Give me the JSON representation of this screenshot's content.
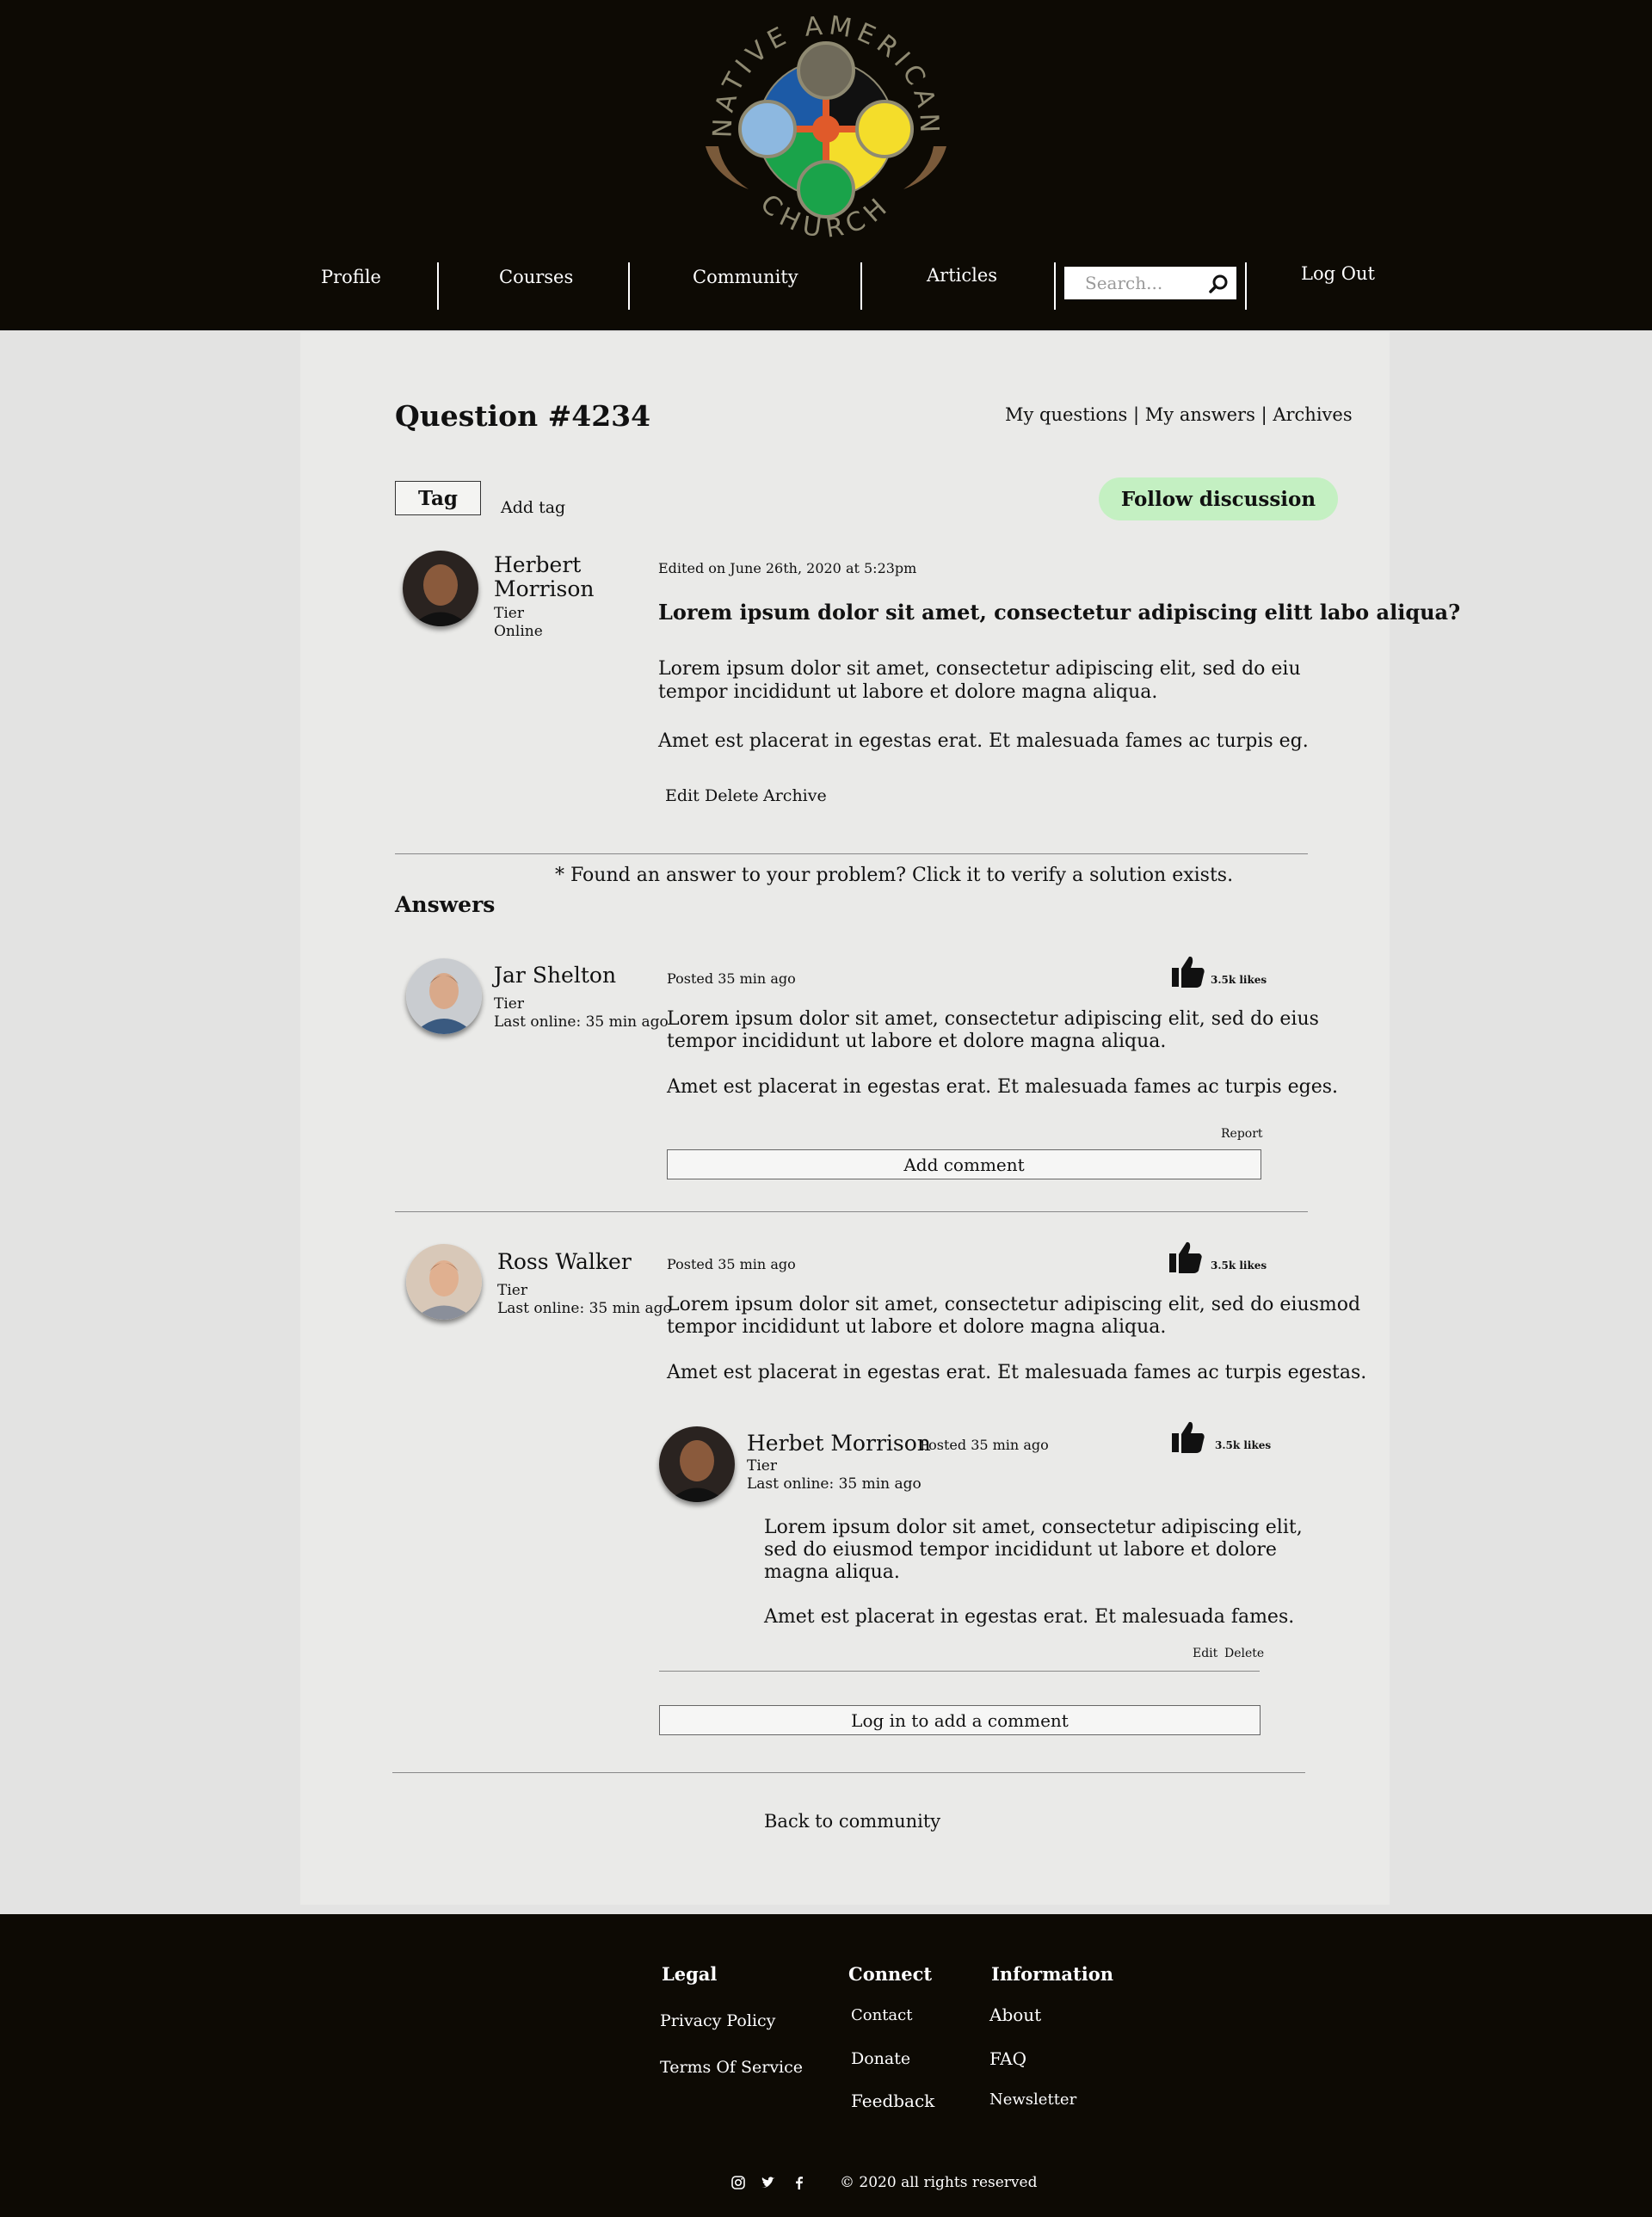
{
  "header": {
    "logo_text_top": "NATIVE AMERICAN",
    "logo_text_bottom": "CHURCH",
    "nav": [
      "Profile",
      "Courses",
      "Community",
      "Articles"
    ],
    "search_placeholder": "Search...",
    "logout": "Log Out"
  },
  "question": {
    "title": "Question #4234",
    "links": [
      "My questions",
      "My answers",
      "Archives"
    ],
    "link_sep": "|",
    "tag": "Tag",
    "add_tag": "Add tag",
    "follow": "Follow discussion",
    "author": {
      "first": "Herbert",
      "last": "Morrison",
      "tier": "Tier",
      "status": "Online"
    },
    "edited": "Edited on June 26th, 2020 at 5:23pm",
    "heading": "Lorem ipsum dolor sit amet, consectetur adipiscing elitt labo aliqua?",
    "p1a": "Lorem ipsum dolor sit amet, consectetur adipiscing elit, sed do eiu",
    "p1b": "tempor incididunt ut labore et dolore magna aliqua.",
    "p2": "Amet est placerat in egestas erat. Et malesuada fames ac turpis eg.",
    "actions": [
      "Edit",
      "Delete",
      "Archive"
    ]
  },
  "hint": "* Found an answer to your problem? Click it to verify a solution exists.",
  "answers_title": "Answers",
  "answers": [
    {
      "name": "Jar Shelton",
      "tier": "Tier",
      "last_online": "Last online: 35 min ago",
      "posted": "Posted 35 min ago",
      "likes": "3.5k likes",
      "p1a": "Lorem ipsum dolor sit amet, consectetur adipiscing elit, sed do eius",
      "p1b": "tempor incididunt ut labore et dolore magna aliqua.",
      "p2": "Amet est placerat in egestas erat. Et malesuada fames ac turpis eges.",
      "report": "Report",
      "add_comment": "Add comment"
    },
    {
      "name": "Ross Walker",
      "tier": "Tier",
      "last_online": "Last online: 35 min ago",
      "posted": "Posted 35 min ago",
      "likes": "3.5k likes",
      "p1a": "Lorem ipsum dolor sit amet, consectetur adipiscing elit, sed do eiusmod",
      "p1b": "tempor incididunt ut labore et dolore magna aliqua.",
      "p2": "Amet est placerat in egestas erat. Et malesuada fames ac turpis egestas.",
      "reply": {
        "name": "Herbet Morrison",
        "posted": "Posted 35 min ago",
        "tier": "Tier",
        "last_online": "Last online: 35 min ago",
        "likes": "3.5k likes",
        "l1": "Lorem ipsum dolor sit amet, consectetur adipiscing elit,",
        "l2": "sed do eiusmod tempor incididunt ut labore et dolore",
        "l3": "magna aliqua.",
        "p2": "Amet est placerat in egestas erat. Et malesuada fames.",
        "edit": "Edit",
        "delete": "Delete"
      },
      "login_comment": "Log in to add a comment"
    }
  ],
  "back": "Back to community",
  "footer": {
    "legal": {
      "title": "Legal",
      "items": [
        "Privacy Policy",
        "Terms Of Service"
      ]
    },
    "connect": {
      "title": "Connect",
      "items": [
        "Contact",
        "Donate",
        "Feedback"
      ]
    },
    "information": {
      "title": "Information",
      "items": [
        "About",
        "FAQ",
        "Newsletter"
      ]
    },
    "copyright": "© 2020 all rights reserved",
    "social_icons": [
      "instagram-icon",
      "twitter-icon",
      "facebook-icon"
    ]
  },
  "colors": {
    "header_bg": "#0d0a04",
    "follow_bg": "#c4f0c2",
    "panel_bg": "#eaeae8"
  }
}
